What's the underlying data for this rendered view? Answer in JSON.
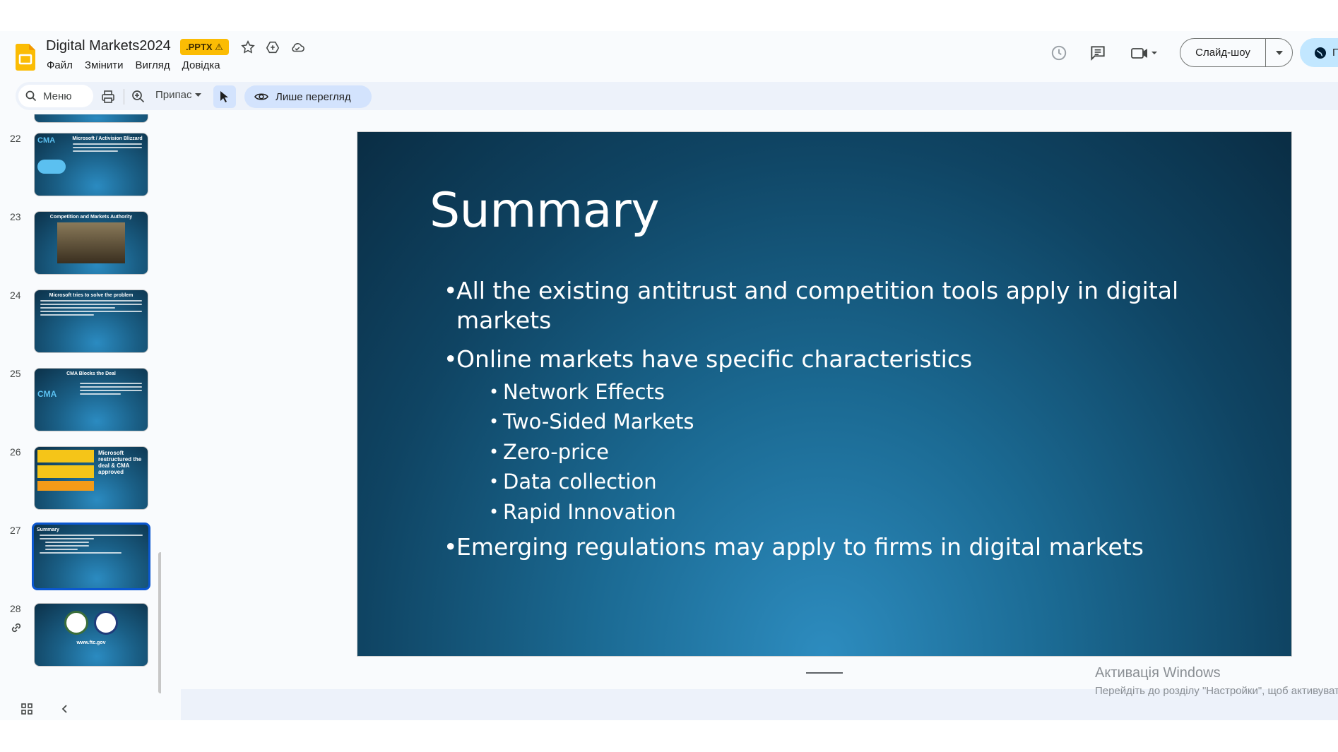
{
  "header": {
    "doc_title": "Digital Markets2024",
    "badge": ".PPTX ⚠",
    "menu": [
      "Файл",
      "Змінити",
      "Вигляд",
      "Довідка"
    ],
    "slideshow_label": "Слайд-шоу",
    "share_label": "П"
  },
  "toolbar": {
    "search_placeholder": "Меню",
    "zoom_label": "Припас",
    "view_only_label": "Лише перегляд"
  },
  "filmstrip": {
    "slides": [
      {
        "num": "22",
        "title": "Microsoft / Activision Blizzard"
      },
      {
        "num": "23",
        "title": "Competition and Markets Authority"
      },
      {
        "num": "24",
        "title": "Microsoft tries to solve the problem"
      },
      {
        "num": "25",
        "title": "CMA Blocks the Deal"
      },
      {
        "num": "26",
        "title": "Microsoft restructured the deal & CMA approved"
      },
      {
        "num": "27",
        "title": "Summary"
      },
      {
        "num": "28",
        "title": "www.ftc.gov"
      }
    ],
    "selected": "27"
  },
  "slide": {
    "title": "Summary",
    "bullets": [
      "All the existing antitrust and competition tools apply in digital",
      "markets",
      "Online markets have specific characteristics",
      "Emerging regulations may apply to firms in digital markets"
    ],
    "subbullets": [
      "Network Effects",
      "Two-Sided Markets",
      "Zero-price",
      "Data collection",
      "Rapid Innovation"
    ]
  },
  "watermark": {
    "line1": "Активація Windows",
    "line2": "Перейдіть до розділу \"Настройки\", щоб активувати"
  },
  "colors": {
    "accent_blue": "#0b57d0",
    "slides_yellow": "#fbbc04",
    "slide_bg_dark": "#0a2d44",
    "slide_bg_light": "#2d8cbf"
  }
}
